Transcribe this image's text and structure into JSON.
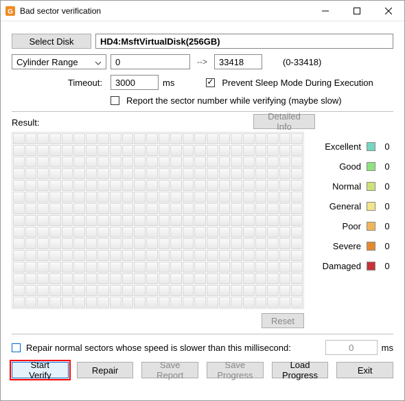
{
  "window": {
    "title": "Bad sector verification"
  },
  "top": {
    "select_disk_label": "Select Disk",
    "disk_name": "HD4:MsftVirtualDisk(256GB)",
    "range_mode": "Cylinder Range",
    "range_start": "0",
    "range_arrow": "-->",
    "range_end": "33418",
    "range_hint": "(0-33418)",
    "timeout_label": "Timeout:",
    "timeout_value": "3000",
    "timeout_unit": "ms",
    "prevent_sleep_checked": true,
    "prevent_sleep_label": "Prevent Sleep Mode During Execution",
    "report_sector_checked": false,
    "report_sector_label": "Report the sector number while verifying (maybe slow)"
  },
  "result": {
    "label": "Result:",
    "detailed_info_label": "Detailed Info",
    "reset_label": "Reset"
  },
  "legend": [
    {
      "name": "Excellent",
      "color": "#74d6c3",
      "count": 0
    },
    {
      "name": "Good",
      "color": "#8fe27e",
      "count": 0
    },
    {
      "name": "Normal",
      "color": "#cee27a",
      "count": 0
    },
    {
      "name": "General",
      "color": "#f2e58a",
      "count": 0
    },
    {
      "name": "Poor",
      "color": "#f0b75a",
      "count": 0
    },
    {
      "name": "Severe",
      "color": "#e38a2e",
      "count": 0
    },
    {
      "name": "Damaged",
      "color": "#c7333a",
      "count": 0
    }
  ],
  "repair": {
    "checkbox_checked": false,
    "label": "Repair normal sectors whose speed is slower than this millisecond:",
    "ms_value": "0",
    "ms_unit": "ms"
  },
  "footer": {
    "start_verify": "Start Verify",
    "repair": "Repair",
    "save_report": "Save Report",
    "save_progress": "Save Progress",
    "load_progress": "Load Progress",
    "exit": "Exit"
  }
}
